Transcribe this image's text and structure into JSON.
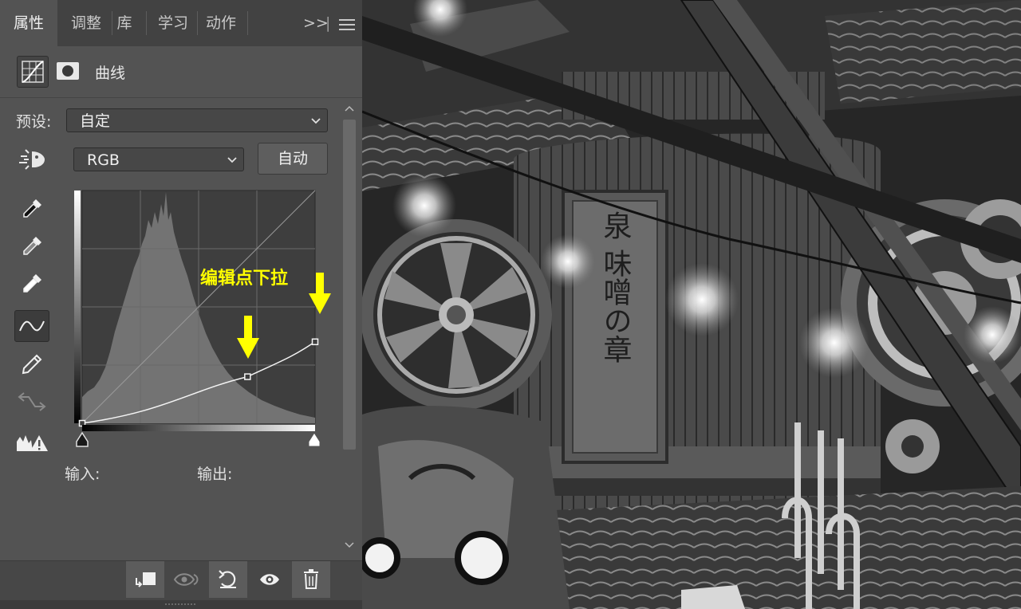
{
  "tabs": [
    {
      "label": "属性",
      "active": true
    },
    {
      "label": "调整",
      "active": false
    },
    {
      "label": "库",
      "active": false
    },
    {
      "label": "学习",
      "active": false
    },
    {
      "label": "动作",
      "active": false
    }
  ],
  "tab_overflow": ">>",
  "tab_divider": "|",
  "menu_icon": "hamburger-menu-icon",
  "header": {
    "title": "曲线",
    "icons": [
      "curves-adjustment-icon",
      "layer-mask-icon"
    ]
  },
  "preset": {
    "label": "预设:",
    "value": "自定"
  },
  "channel": {
    "value": "RGB"
  },
  "auto_button": "自动",
  "tools": [
    "on-image-adjust-icon",
    "black-point-eyedropper-icon",
    "gray-point-eyedropper-icon",
    "white-point-eyedropper-icon",
    "curve-points-icon",
    "pencil-draw-icon",
    "smooth-curve-icon",
    "clipping-warning-icon"
  ],
  "curve": {
    "points": [
      [
        0,
        0
      ],
      [
        0.71,
        0.2
      ],
      [
        1,
        0.35
      ]
    ],
    "annotation": "编辑点下拉",
    "accent_color": "#ffff00"
  },
  "input_label": "输入:",
  "output_label": "输出:",
  "bottom_tools": [
    "clip-to-layer-icon",
    "view-previous-state-icon",
    "reset-icon",
    "visibility-eye-icon",
    "delete-trash-icon"
  ],
  "canvas": {
    "sign_text": "泉 味噌の章"
  }
}
